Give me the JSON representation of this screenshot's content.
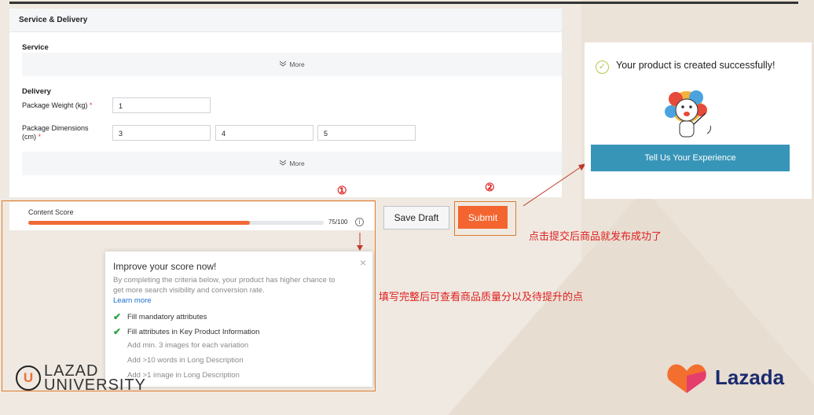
{
  "panel": {
    "section_title": "Service & Delivery",
    "service_title": "Service",
    "more_label": "More",
    "delivery_title": "Delivery",
    "weight_label": "Package Weight (kg)",
    "weight_value": "1",
    "dimensions_label": "Package Dimensions (cm)",
    "dim_length": "3",
    "dim_width": "4",
    "dim_height": "5",
    "required_mark": "*"
  },
  "score": {
    "label": "Content Score",
    "value": 75,
    "value_text": "75/100",
    "info_glyph": "i"
  },
  "actions": {
    "save_draft": "Save Draft",
    "submit": "Submit"
  },
  "markers": {
    "one": "①",
    "two": "②"
  },
  "tooltip": {
    "title": "Improve your score now!",
    "description": "By completing the criteria below, your product has higher chance to get more search visibility and conversion rate.",
    "link": "Learn more",
    "close": "×",
    "items": [
      {
        "text": "Fill mandatory attributes",
        "done": true
      },
      {
        "text": "Fill attributes in Key Product Information",
        "done": true
      },
      {
        "text": "Add min. 3 images for each variation",
        "done": false
      },
      {
        "text": "Add >10 words in Long Description",
        "done": false
      },
      {
        "text": "Add >1 image in Long Description",
        "done": false
      }
    ]
  },
  "success": {
    "message": "Your product is created successfully!",
    "button": "Tell Us Your Experience"
  },
  "notes": {
    "submit_note": "点击提交后商品就发布成功了",
    "score_note": "填写完整后可查看商品质量分以及待提升的点"
  },
  "logos": {
    "university_u": "U",
    "university_text_1": "LAZAD",
    "university_text_2": "UNIVERSITY",
    "lazada": "Lazada"
  },
  "colors": {
    "accent_orange": "#f3642f",
    "annotation_red": "#e02020",
    "success_button": "#3795b8",
    "check_green": "#2ea04a"
  }
}
